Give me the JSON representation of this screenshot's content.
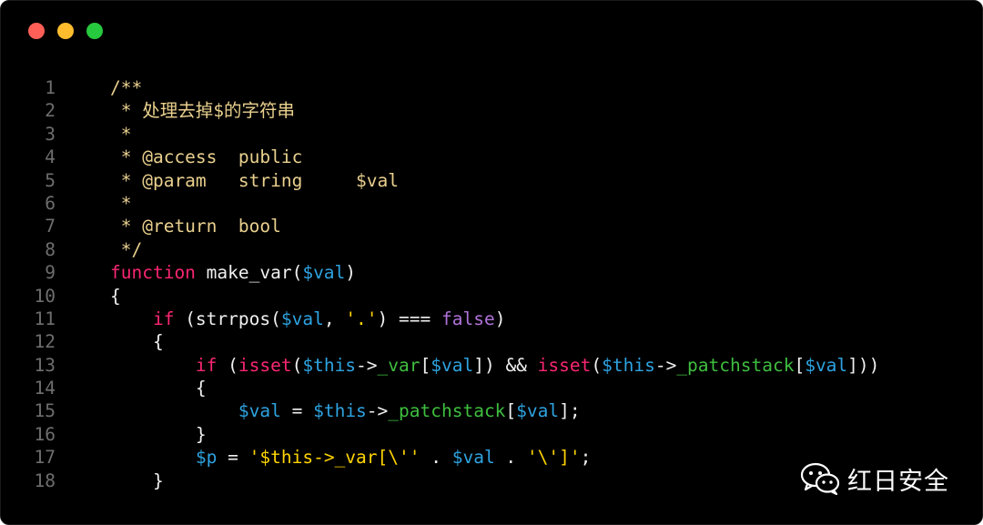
{
  "window": {
    "controls": [
      "close",
      "minimize",
      "maximize"
    ],
    "colors": {
      "background": "#000000",
      "close": "#ff5f56",
      "minimize": "#ffbd2e",
      "maximize": "#27c93f"
    }
  },
  "code": {
    "language": "php",
    "line_numbers": [
      "1",
      "2",
      "3",
      "4",
      "5",
      "6",
      "7",
      "8",
      "9",
      "10",
      "11",
      "12",
      "13",
      "14",
      "15",
      "16",
      "17",
      "18"
    ],
    "lines": [
      [
        {
          "t": "/**",
          "c": "com"
        }
      ],
      [
        {
          "t": " * 处理去掉$的字符串",
          "c": "com"
        }
      ],
      [
        {
          "t": " *",
          "c": "com"
        }
      ],
      [
        {
          "t": " * @access  public",
          "c": "com"
        }
      ],
      [
        {
          "t": " * @param   string     $val",
          "c": "com"
        }
      ],
      [
        {
          "t": " *",
          "c": "com"
        }
      ],
      [
        {
          "t": " * @return  bool",
          "c": "com"
        }
      ],
      [
        {
          "t": " */",
          "c": "com"
        }
      ],
      [
        {
          "t": "function",
          "c": "kw"
        },
        {
          "t": " make_var(",
          "c": "def"
        },
        {
          "t": "$val",
          "c": "var"
        },
        {
          "t": ")",
          "c": "def"
        }
      ],
      [
        {
          "t": "{",
          "c": "def"
        }
      ],
      [
        {
          "t": "    ",
          "c": "def"
        },
        {
          "t": "if",
          "c": "kw"
        },
        {
          "t": " (strrpos(",
          "c": "def"
        },
        {
          "t": "$val",
          "c": "var"
        },
        {
          "t": ", ",
          "c": "def"
        },
        {
          "t": "'.'",
          "c": "str"
        },
        {
          "t": ") === ",
          "c": "def"
        },
        {
          "t": "false",
          "c": "bool"
        },
        {
          "t": ")",
          "c": "def"
        }
      ],
      [
        {
          "t": "    {",
          "c": "def"
        }
      ],
      [
        {
          "t": "        ",
          "c": "def"
        },
        {
          "t": "if",
          "c": "kw"
        },
        {
          "t": " (",
          "c": "def"
        },
        {
          "t": "isset",
          "c": "fn"
        },
        {
          "t": "(",
          "c": "def"
        },
        {
          "t": "$this",
          "c": "var"
        },
        {
          "t": "->",
          "c": "def"
        },
        {
          "t": "_var",
          "c": "prop"
        },
        {
          "t": "[",
          "c": "def"
        },
        {
          "t": "$val",
          "c": "var"
        },
        {
          "t": "]) && ",
          "c": "def"
        },
        {
          "t": "isset",
          "c": "fn"
        },
        {
          "t": "(",
          "c": "def"
        },
        {
          "t": "$this",
          "c": "var"
        },
        {
          "t": "->",
          "c": "def"
        },
        {
          "t": "_patchstack",
          "c": "prop"
        },
        {
          "t": "[",
          "c": "def"
        },
        {
          "t": "$val",
          "c": "var"
        },
        {
          "t": "]))",
          "c": "def"
        }
      ],
      [
        {
          "t": "        {",
          "c": "def"
        }
      ],
      [
        {
          "t": "            ",
          "c": "def"
        },
        {
          "t": "$val",
          "c": "var"
        },
        {
          "t": " = ",
          "c": "def"
        },
        {
          "t": "$this",
          "c": "var"
        },
        {
          "t": "->",
          "c": "def"
        },
        {
          "t": "_patchstack",
          "c": "prop"
        },
        {
          "t": "[",
          "c": "def"
        },
        {
          "t": "$val",
          "c": "var"
        },
        {
          "t": "];",
          "c": "def"
        }
      ],
      [
        {
          "t": "        }",
          "c": "def"
        }
      ],
      [
        {
          "t": "        ",
          "c": "def"
        },
        {
          "t": "$p",
          "c": "var"
        },
        {
          "t": " = ",
          "c": "def"
        },
        {
          "t": "'$this->_var[\\''",
          "c": "str"
        },
        {
          "t": " . ",
          "c": "def"
        },
        {
          "t": "$val",
          "c": "var"
        },
        {
          "t": " . ",
          "c": "def"
        },
        {
          "t": "'\\']'",
          "c": "str"
        },
        {
          "t": ";",
          "c": "def"
        }
      ],
      [
        {
          "t": "    }",
          "c": "def"
        }
      ]
    ]
  },
  "watermark": {
    "icon": "wechat-icon",
    "text": "红日安全"
  }
}
